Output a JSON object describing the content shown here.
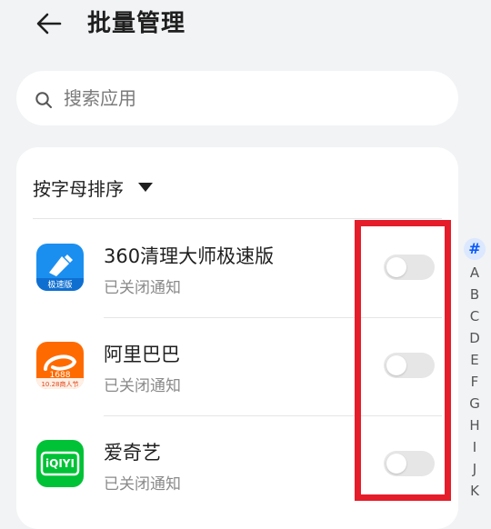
{
  "header": {
    "back_icon": "arrow-left-icon",
    "title": "批量管理"
  },
  "search": {
    "icon": "search-icon",
    "placeholder": "搜索应用",
    "value": ""
  },
  "sort": {
    "label": "按字母排序",
    "caret_icon": "caret-down-icon"
  },
  "apps": [
    {
      "name": "360清理大师极速版",
      "status": "已关闭通知",
      "icon": "360-cleaner-icon",
      "icon_caption": "极速版",
      "notifications_on": false
    },
    {
      "name": "阿里巴巴",
      "status": "已关闭通知",
      "icon": "alibaba-1688-icon",
      "icon_caption": "1688",
      "icon_sub": "10.28商人节",
      "notifications_on": false
    },
    {
      "name": "爱奇艺",
      "status": "已关闭通知",
      "icon": "iqiyi-icon",
      "icon_caption": "iQIYI",
      "notifications_on": false
    }
  ],
  "alpha_index": {
    "active": "#",
    "letters": [
      "A",
      "B",
      "C",
      "D",
      "E",
      "F",
      "G",
      "H",
      "I",
      "J",
      "K"
    ]
  },
  "colors": {
    "background": "#f1f3f5",
    "accent": "#0a59f7",
    "highlight": "#e51d2a",
    "toggle_off": "#e6e6e6"
  }
}
